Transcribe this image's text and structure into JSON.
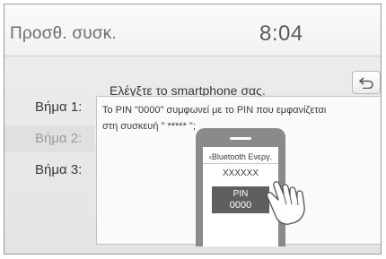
{
  "header": {
    "title": "Προσθ. συσκ.",
    "clock": "8:04"
  },
  "instruction": "Ελέγξτε το smartphone σας.",
  "steps": [
    {
      "label": "Βήμα 1:"
    },
    {
      "label": "Βήμα 2:",
      "active": true
    },
    {
      "label": "Βήμα 3:"
    }
  ],
  "message": {
    "line1": "Το PIN \"0000\" συμφωνεί με το PIN που εμφανίζεται",
    "line2": "στη συσκευή \" ***** \";"
  },
  "phone": {
    "header": "Bluetooth Ενεργ.",
    "device_name": "XXXXXX",
    "pin_label": "PIN",
    "pin_value": "0000"
  },
  "icons": {
    "back": "back-arrow-icon",
    "phone_back": "chevron-left-icon",
    "hand": "hand-pointer-icon"
  }
}
